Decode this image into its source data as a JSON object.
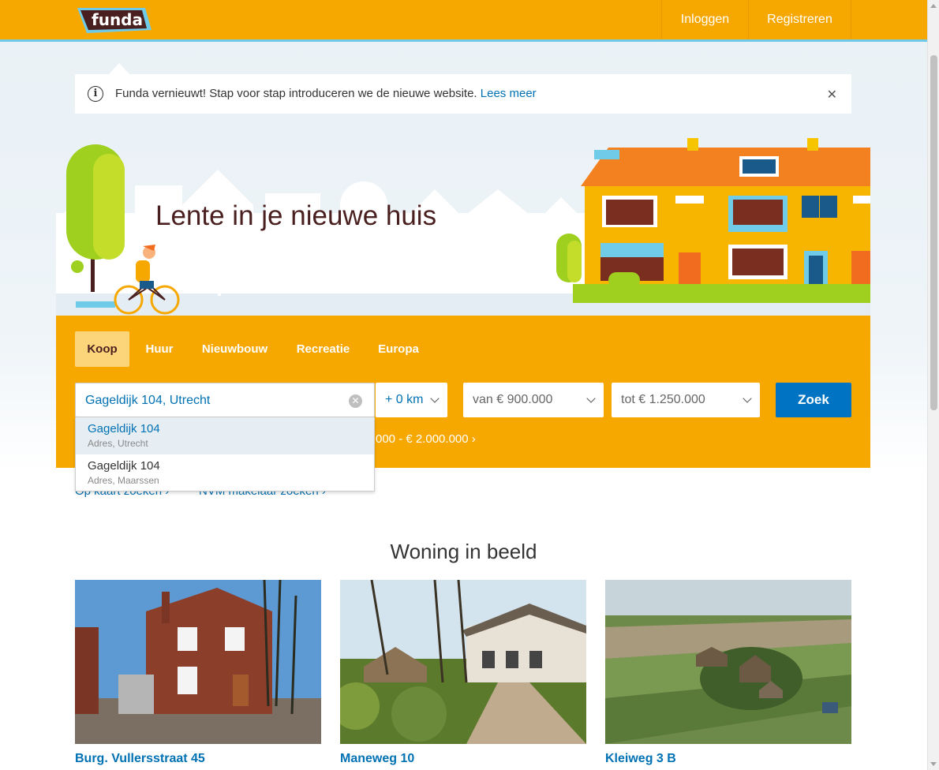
{
  "header": {
    "logo_text": "funda",
    "nav": {
      "login": "Inloggen",
      "register": "Registreren"
    },
    "colors": {
      "brand": "#f7a800",
      "accent": "#6fcbe8"
    }
  },
  "notice": {
    "text": "Funda vernieuwt! Stap voor stap introduceren we de nieuwe website.",
    "link": "Lees meer",
    "icon": "info-icon",
    "close_icon": "close-icon"
  },
  "hero": {
    "title": "Lente in je nieuwe huis"
  },
  "search": {
    "tabs": [
      "Koop",
      "Huur",
      "Nieuwbouw",
      "Recreatie",
      "Europa"
    ],
    "active_tab": "Koop",
    "query": "Gageldijk 104, Utrecht",
    "radius": "+ 0 km",
    "price_from": "van  € 900.000",
    "price_to": "tot  € 1.250.000",
    "submit": "Zoek",
    "price_hint": "000 - € 2.000.000  ›",
    "suggestions": [
      {
        "title": "Gageldijk 104",
        "sub": "Adres, Utrecht"
      },
      {
        "title": "Gageldijk 104",
        "sub": "Adres, Maarssen"
      }
    ],
    "links": [
      "Op kaart zoeken  ›",
      "NVM makelaar zoeken  ›"
    ]
  },
  "section": {
    "title": "Woning in beeld",
    "cards": [
      {
        "label": "Burg. Vullersstraat 45"
      },
      {
        "label": "Maneweg 10"
      },
      {
        "label": "Kleiweg 3 B"
      }
    ]
  }
}
